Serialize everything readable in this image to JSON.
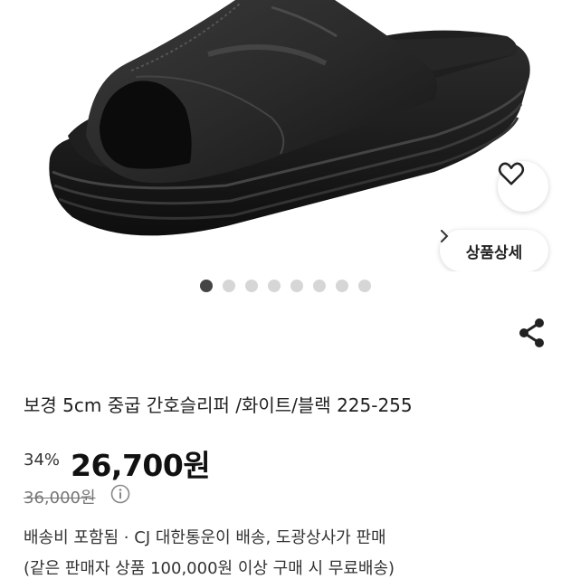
{
  "product": {
    "title": "보경 5cm 중굽 간호슬리퍼 /화이트/블랙 225-255",
    "discount": "34%",
    "price": "26,700원",
    "original_price": "36,000원",
    "shipping": "배송비 포함됨 ·  CJ 대한통운이 배송, 도광상사가 판매",
    "shipping_note": "(같은 판매자 상품 100,000원 이상 구매 시 무료배송)"
  },
  "gallery": {
    "detail_label": "상품상세",
    "image_count": 8,
    "active_index": 0
  },
  "icons": {
    "wishlist": "heart-icon",
    "detail": "chevron-right-icon",
    "share": "share-icon",
    "info": "info-icon"
  }
}
